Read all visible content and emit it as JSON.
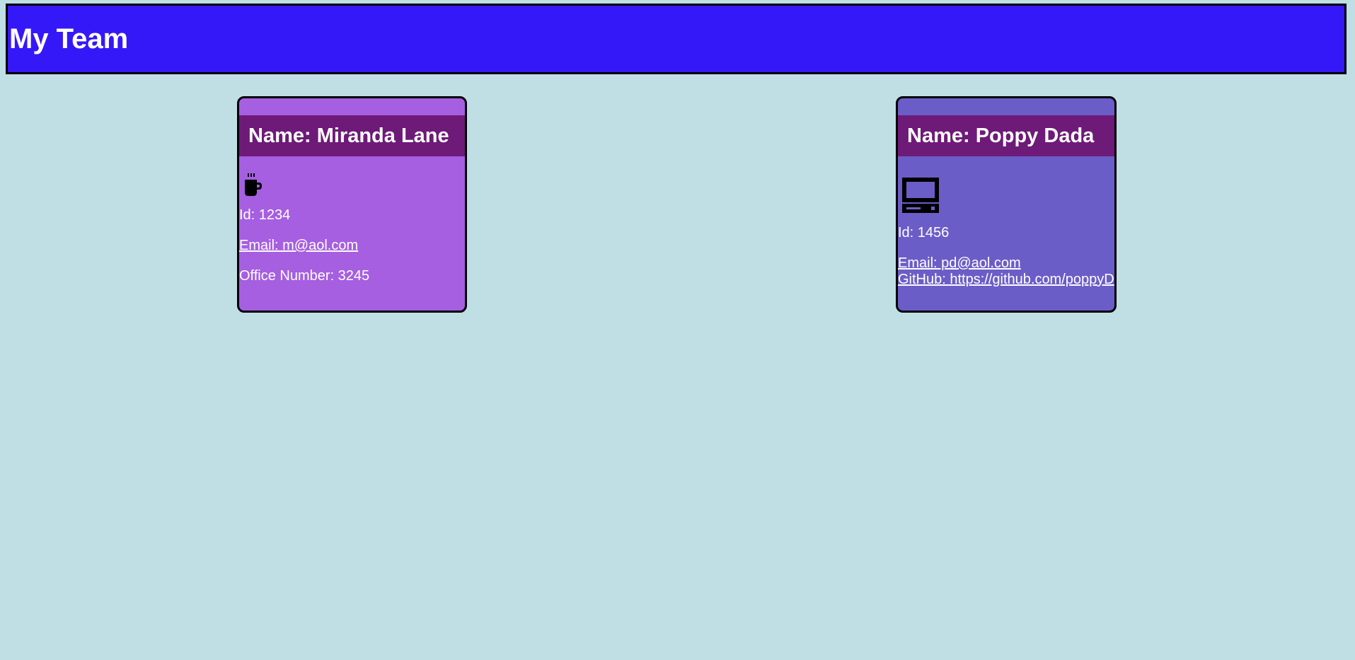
{
  "header": {
    "title": "My Team"
  },
  "colors": {
    "background": "#c0dfe4",
    "header": "#3518f8",
    "manager_card": "#a55fe0",
    "engineer_card": "#6b5dc7",
    "name_band": "#6e1a78"
  },
  "team": [
    {
      "role_icon": "coffee-mug-icon",
      "name": "Name: Miranda Lane",
      "id": "Id: 1234",
      "email": "Email: m@aol.com",
      "extra": "Office Number: 3245"
    },
    {
      "role_icon": "computer-icon",
      "name": "Name: Poppy Dada",
      "id": "Id: 1456",
      "email": "Email: pd@aol.com",
      "extra": "GitHub: https://github.com/poppyD"
    }
  ]
}
